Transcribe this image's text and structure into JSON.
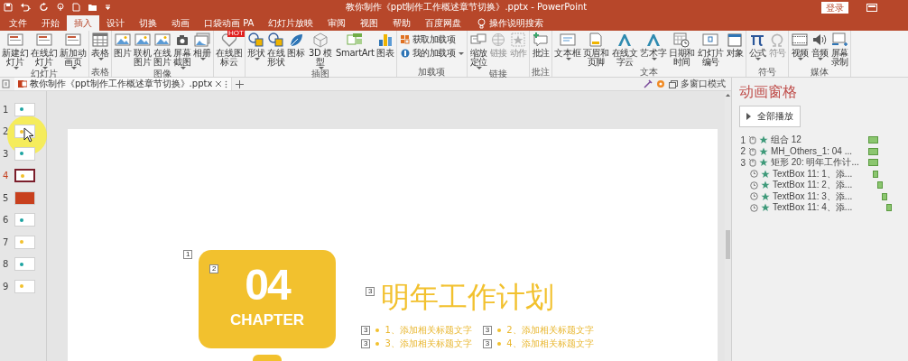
{
  "window": {
    "title": "教你制作《ppt制作工作概述章节切换》.pptx  -  PowerPoint",
    "login": "登录"
  },
  "menu_tabs": [
    {
      "label": "文件",
      "selected": false
    },
    {
      "label": "开始",
      "selected": false
    },
    {
      "label": "插入",
      "selected": true
    },
    {
      "label": "设计",
      "selected": false
    },
    {
      "label": "切换",
      "selected": false
    },
    {
      "label": "动画",
      "selected": false
    },
    {
      "label": "口袋动画 PA",
      "selected": false
    },
    {
      "label": "幻灯片放映",
      "selected": false
    },
    {
      "label": "审阅",
      "selected": false
    },
    {
      "label": "视图",
      "selected": false
    },
    {
      "label": "帮助",
      "selected": false
    },
    {
      "label": "百度网盘",
      "selected": false
    }
  ],
  "search": {
    "label": "操作说明搜索"
  },
  "ribbon": [
    {
      "label": "幻灯片",
      "buttons": [
        {
          "kind": "large",
          "label": "新建幻灯片",
          "dropdown": true,
          "disabled": false
        },
        {
          "kind": "large",
          "label": "在线幻灯片",
          "dropdown": true,
          "disabled": false
        },
        {
          "kind": "large",
          "label": "新加动画页",
          "dropdown": true,
          "disabled": false
        }
      ]
    },
    {
      "label": "表格",
      "buttons": [
        {
          "kind": "large",
          "label": "表格",
          "dropdown": true,
          "disabled": false
        }
      ]
    },
    {
      "label": "图像",
      "buttons": [
        {
          "kind": "large",
          "label": "图片",
          "dropdown": false,
          "disabled": false
        },
        {
          "kind": "large",
          "label": "联机图片",
          "dropdown": false,
          "disabled": false
        },
        {
          "kind": "large",
          "label": "在线图片",
          "dropdown": false,
          "disabled": false
        },
        {
          "kind": "large",
          "label": "屏幕截图",
          "dropdown": true,
          "disabled": false
        },
        {
          "kind": "large",
          "label": "相册",
          "dropdown": true,
          "disabled": false
        }
      ]
    },
    {
      "buttons": [
        {
          "kind": "large",
          "label": "在线图标云",
          "badge": "HOT",
          "dropdown": false,
          "disabled": false
        }
      ]
    },
    {
      "label": "插图",
      "buttons": [
        {
          "kind": "large",
          "label": "形状",
          "dropdown": true,
          "disabled": false
        },
        {
          "kind": "large",
          "label": "在线形状",
          "dropdown": false,
          "disabled": false
        },
        {
          "kind": "large",
          "label": "图标",
          "dropdown": false,
          "disabled": false
        },
        {
          "kind": "large",
          "label": "3D 模型",
          "dropdown": true,
          "disabled": false
        },
        {
          "kind": "large",
          "label": "SmartArt",
          "dropdown": false,
          "disabled": false
        },
        {
          "kind": "large",
          "label": "图表",
          "dropdown": false,
          "disabled": false
        }
      ]
    },
    {
      "label": "加载项",
      "buttons": [
        {
          "kind": "small",
          "label": "获取加载项",
          "dropdown": false,
          "disabled": false
        },
        {
          "kind": "small",
          "label": "我的加载项",
          "dropdown": true,
          "disabled": false
        }
      ]
    },
    {
      "label": "链接",
      "buttons": [
        {
          "kind": "large",
          "label": "缩放定位",
          "dropdown": true,
          "disabled": false
        },
        {
          "kind": "large",
          "label": "链接",
          "dropdown": false,
          "disabled": true
        },
        {
          "kind": "large",
          "label": "动作",
          "dropdown": false,
          "disabled": true
        }
      ]
    },
    {
      "label": "批注",
      "buttons": [
        {
          "kind": "large",
          "label": "批注",
          "dropdown": false,
          "disabled": false
        }
      ]
    },
    {
      "label": "文本",
      "buttons": [
        {
          "kind": "large",
          "label": "文本框",
          "dropdown": true,
          "disabled": false
        },
        {
          "kind": "large",
          "label": "页眉和页脚",
          "dropdown": false,
          "disabled": false
        },
        {
          "kind": "large",
          "label": "在线文字云",
          "dropdown": false,
          "disabled": false
        },
        {
          "kind": "large",
          "label": "艺术字",
          "dropdown": true,
          "disabled": false
        },
        {
          "kind": "large",
          "label": "日期和时间",
          "dropdown": false,
          "disabled": false
        },
        {
          "kind": "large",
          "label": "幻灯片编号",
          "dropdown": false,
          "disabled": false
        },
        {
          "kind": "large",
          "label": "对象",
          "dropdown": false,
          "disabled": false
        }
      ]
    },
    {
      "label": "符号",
      "buttons": [
        {
          "kind": "large",
          "label": "公式",
          "dropdown": true,
          "disabled": false
        },
        {
          "kind": "large",
          "label": "符号",
          "dropdown": false,
          "disabled": true
        }
      ]
    },
    {
      "label": "媒体",
      "buttons": [
        {
          "kind": "large",
          "label": "视频",
          "dropdown": true,
          "disabled": false
        },
        {
          "kind": "large",
          "label": "音频",
          "dropdown": true,
          "disabled": false
        },
        {
          "kind": "large",
          "label": "屏幕录制",
          "dropdown": false,
          "disabled": false
        }
      ]
    }
  ],
  "document_tab": {
    "label": "教你制作《ppt制作工作概述章节切换》.pptx"
  },
  "window_mode": {
    "label": "多窗口模式"
  },
  "slides": [
    {
      "number": "1",
      "kind": "content",
      "color": "#1ca3a1",
      "selected": false
    },
    {
      "number": "2",
      "kind": "content",
      "color": "#f2c12e",
      "selected": false
    },
    {
      "number": "3",
      "kind": "content",
      "color": "#1ca3a1",
      "selected": false
    },
    {
      "number": "4",
      "kind": "content",
      "color": "#f2c12e",
      "selected": true
    },
    {
      "number": "5",
      "kind": "cover",
      "color": "#c8401e",
      "selected": false
    },
    {
      "number": "6",
      "kind": "content",
      "color": "#1ca3a1",
      "selected": false
    },
    {
      "number": "7",
      "kind": "content",
      "color": "#f2c12e",
      "selected": false
    },
    {
      "number": "8",
      "kind": "content",
      "color": "#1ca3a1",
      "selected": false
    },
    {
      "number": "9",
      "kind": "content",
      "color": "#f2c12e",
      "selected": false
    }
  ],
  "slide": {
    "group_tag": "1",
    "chapter": {
      "tag": "2",
      "number": "04",
      "label": "CHAPTER"
    },
    "title": {
      "tag": "3",
      "text": "明年工作计划"
    },
    "bullets": [
      {
        "tag": "3",
        "text": "1、添加相关标题文字"
      },
      {
        "tag": "3",
        "text": "2、添加相关标题文字"
      },
      {
        "tag": "3",
        "text": "3、添加相关标题文字"
      },
      {
        "tag": "3",
        "text": "4、添加相关标题文字"
      }
    ]
  },
  "animation_pane": {
    "title": "动画窗格",
    "play_all": "全部播放",
    "items": [
      {
        "kind": "click",
        "order": "1",
        "name": "组合 12"
      },
      {
        "kind": "click",
        "order": "2",
        "name": "MH_Others_1: 04 ..."
      },
      {
        "kind": "click",
        "order": "3",
        "name": "矩形 20: 明年工作计..."
      },
      {
        "kind": "after",
        "name": "TextBox 11: 1、添..."
      },
      {
        "kind": "after",
        "name": "TextBox 11: 2、添..."
      },
      {
        "kind": "after",
        "name": "TextBox 11: 3、添..."
      },
      {
        "kind": "after",
        "name": "TextBox 11: 4、添..."
      }
    ]
  }
}
